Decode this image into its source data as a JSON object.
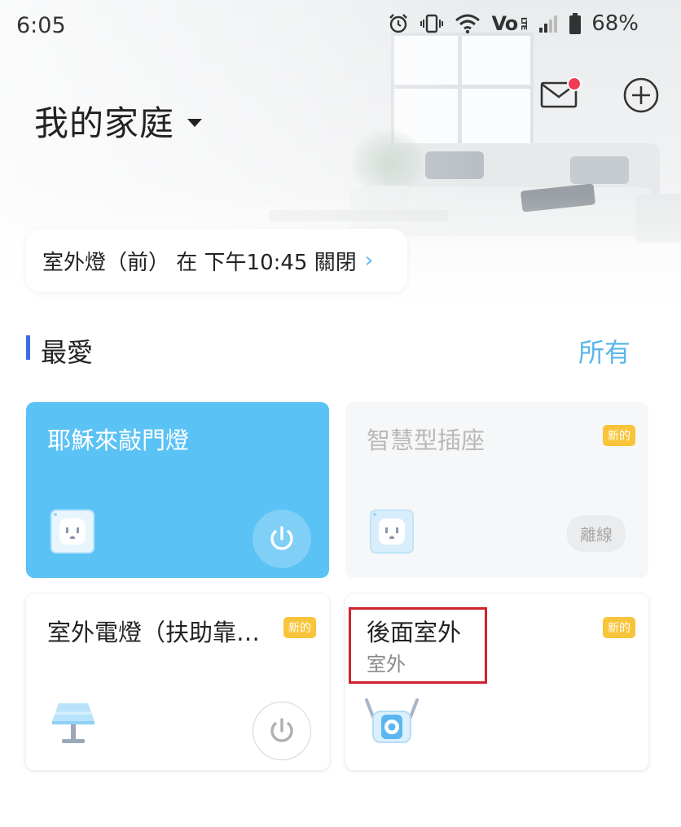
{
  "status_bar": {
    "time": "6:05",
    "volte_label": "Vo",
    "lte_label": "LTE",
    "battery": "68%"
  },
  "header": {
    "home_name": "我的家庭"
  },
  "schedule": {
    "text": "室外燈（前） 在 下午10:45 關閉",
    "chevron": "›"
  },
  "section": {
    "title": "最愛",
    "all_label": "所有"
  },
  "devices": [
    {
      "name": "耶穌來敲門燈",
      "state": "on",
      "icon": "smart-plug-icon",
      "has_power": true
    },
    {
      "name": "智慧型插座",
      "state": "offline",
      "badge": "新的",
      "offline_label": "離線",
      "icon": "smart-plug-icon"
    },
    {
      "name": "室外電燈（扶助靠…",
      "state": "off",
      "badge": "新的",
      "icon": "lamp-icon",
      "has_power": true
    },
    {
      "name": "後面室外",
      "subtitle": "室外",
      "badge": "新的",
      "icon": "camera-icon"
    }
  ],
  "colors": {
    "accent": "#5ab6ea",
    "card_on": "#5bc2f5",
    "badge": "#f8c43a",
    "notification_dot": "#ef3b54",
    "section_bar": "#3c6de0",
    "highlight": "#d2222d"
  }
}
